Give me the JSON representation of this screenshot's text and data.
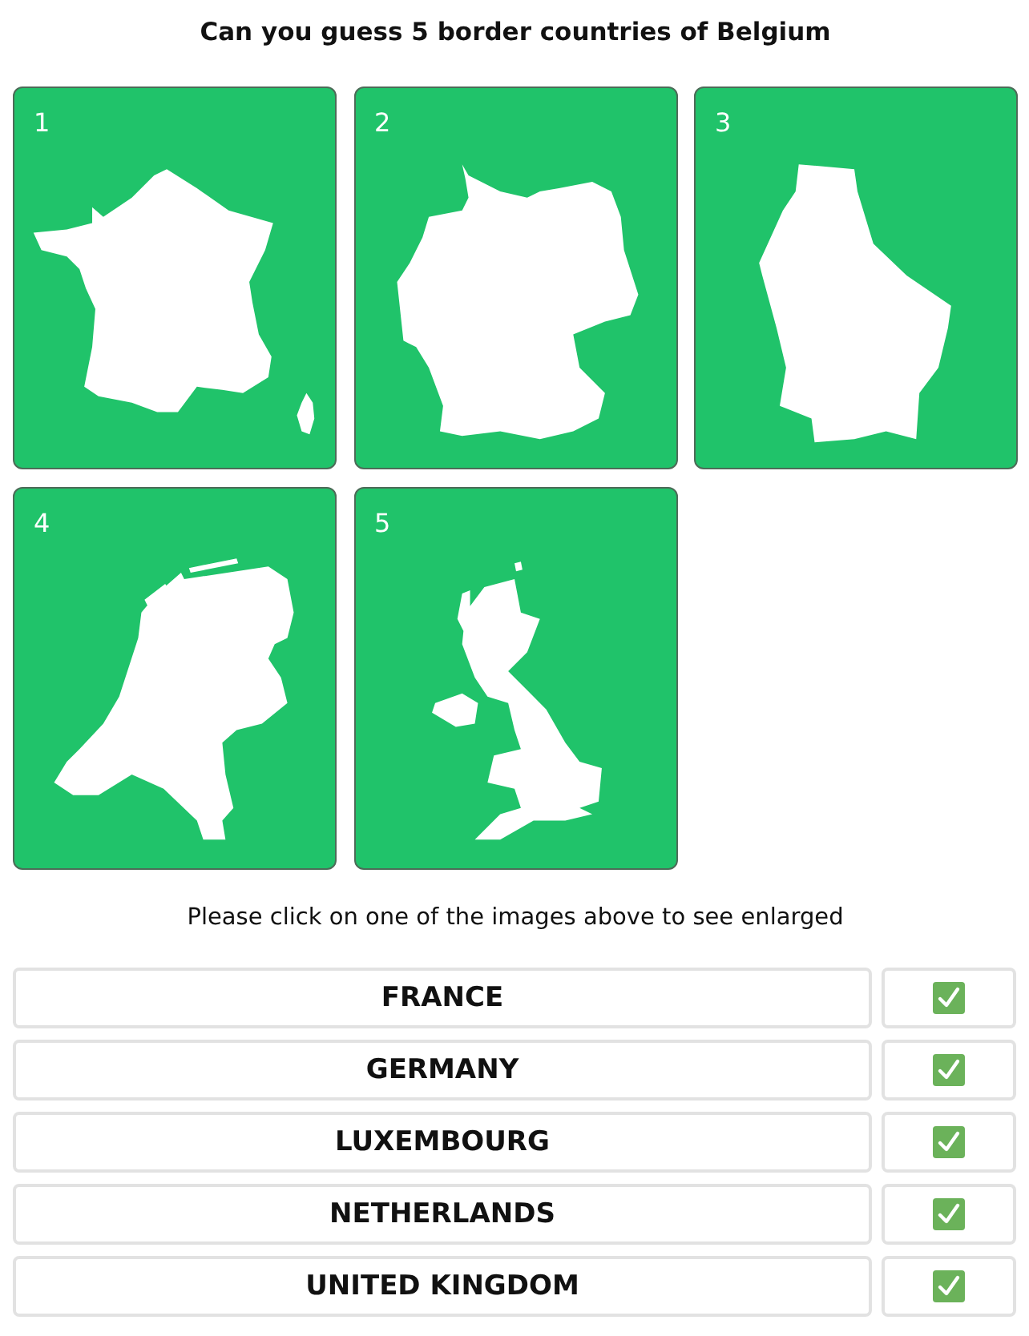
{
  "title": "Can you guess 5 border countries of Belgium",
  "tiles": [
    {
      "number": "1"
    },
    {
      "number": "2"
    },
    {
      "number": "3"
    },
    {
      "number": "4"
    },
    {
      "number": "5"
    }
  ],
  "instruction": "Please click on one of the images above to see enlarged",
  "answers": [
    {
      "label": "FRANCE",
      "checked": true
    },
    {
      "label": "GERMANY",
      "checked": true
    },
    {
      "label": "LUXEMBOURG",
      "checked": true
    },
    {
      "label": "NETHERLANDS",
      "checked": true
    },
    {
      "label": "UNITED KINGDOM",
      "checked": true
    }
  ]
}
